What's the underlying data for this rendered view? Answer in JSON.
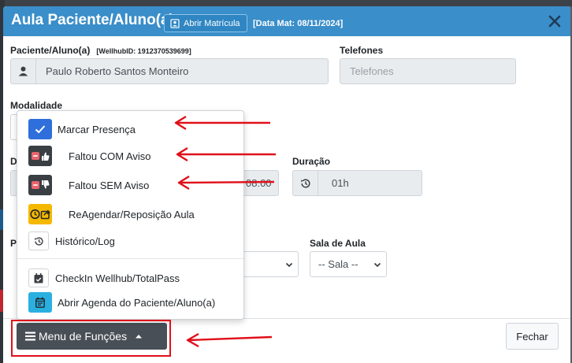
{
  "modal": {
    "title": "Aula Paciente/Aluno(a)",
    "matricula_button": "Abrir Matrícula",
    "data_mat": "[Data Mat: 08/11/2024]"
  },
  "form": {
    "paciente_label": "Paciente/Aluno(a)",
    "wellhub_id": "[WellhubID: 1912370539699]",
    "paciente_value": "Paulo Roberto Santos Monteiro",
    "telefones_label": "Telefones",
    "telefones_placeholder": "Telefones",
    "modalidade_label": "Modalidade",
    "data_label_partial": "D",
    "hora_fim_partial": "08:00",
    "duracao_label": "Duração",
    "duracao_value": "01h",
    "profissional_label_partial": "P",
    "sala_label": "Sala de Aula",
    "sala_value": "-- Sala --"
  },
  "dropdown": {
    "items": [
      {
        "label": "Marcar Presença",
        "icon": "check-icon",
        "color": "#2f6fdb"
      },
      {
        "label": "Faltou COM Aviso",
        "icon": "thumbs-up-icon",
        "color": "#3a3f44"
      },
      {
        "label": "Faltou SEM Aviso",
        "icon": "thumbs-down-icon",
        "color": "#3a3f44"
      },
      {
        "label": "ReAgendar/Reposição Aula",
        "icon": "clock-share-icon",
        "color": "#f5b800"
      },
      {
        "label": "Histórico/Log",
        "icon": "history-icon",
        "color": "#ffffff"
      },
      {
        "label": "CheckIn Wellhub/TotalPass",
        "icon": "calendar-check-icon",
        "color": "#ffffff"
      },
      {
        "label": "Abrir Agenda do Paciente/Aluno(a)",
        "icon": "calendar-icon",
        "color": "#2ab0e0"
      }
    ]
  },
  "footer": {
    "menu_button": "Menu de Funções",
    "close_button": "Fechar"
  },
  "colors": {
    "header": "#3a8ec9",
    "annotation": "#e0101a",
    "dark_button": "#494f56"
  }
}
